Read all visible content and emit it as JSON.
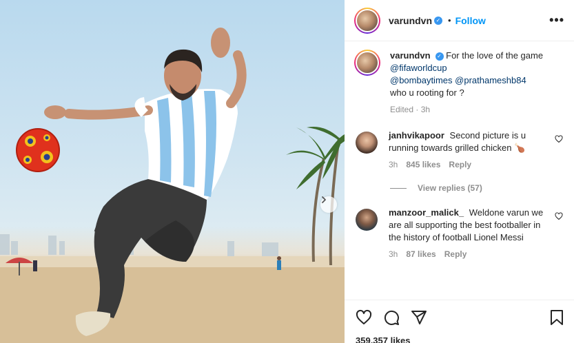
{
  "post": {
    "author": "varundvn",
    "follow_label": "Follow",
    "separator": "•",
    "more_label": "•••",
    "caption": {
      "text": "For the love of the game",
      "mentions": [
        "@fifaworldcup",
        "@bombaytimes",
        "@prathameshb84"
      ],
      "tail": "who u rooting for ?",
      "edited": "Edited · 3h"
    }
  },
  "comments": [
    {
      "user": "janhvikapoor",
      "text": "Second picture is u running towards grilled chicken 🍗",
      "time": "3h",
      "likes": "845 likes",
      "reply": "Reply"
    },
    {
      "user": "manzoor_malick_",
      "text": "Weldone varun we are all supporting the best footballer in the history of football Lionel Messi",
      "time": "3h",
      "likes": "87 likes",
      "reply": "Reply"
    }
  ],
  "view_replies": "View replies (57)",
  "likes_total": "359,357 likes",
  "colors": {
    "follow": "#0095f6",
    "verified": "#3897f0",
    "mention": "#00376b",
    "muted": "#8e8e8e"
  },
  "icons": [
    "chevron-right-icon",
    "verified-icon",
    "more-icon",
    "heart-icon",
    "comment-icon",
    "share-icon",
    "bookmark-icon"
  ]
}
